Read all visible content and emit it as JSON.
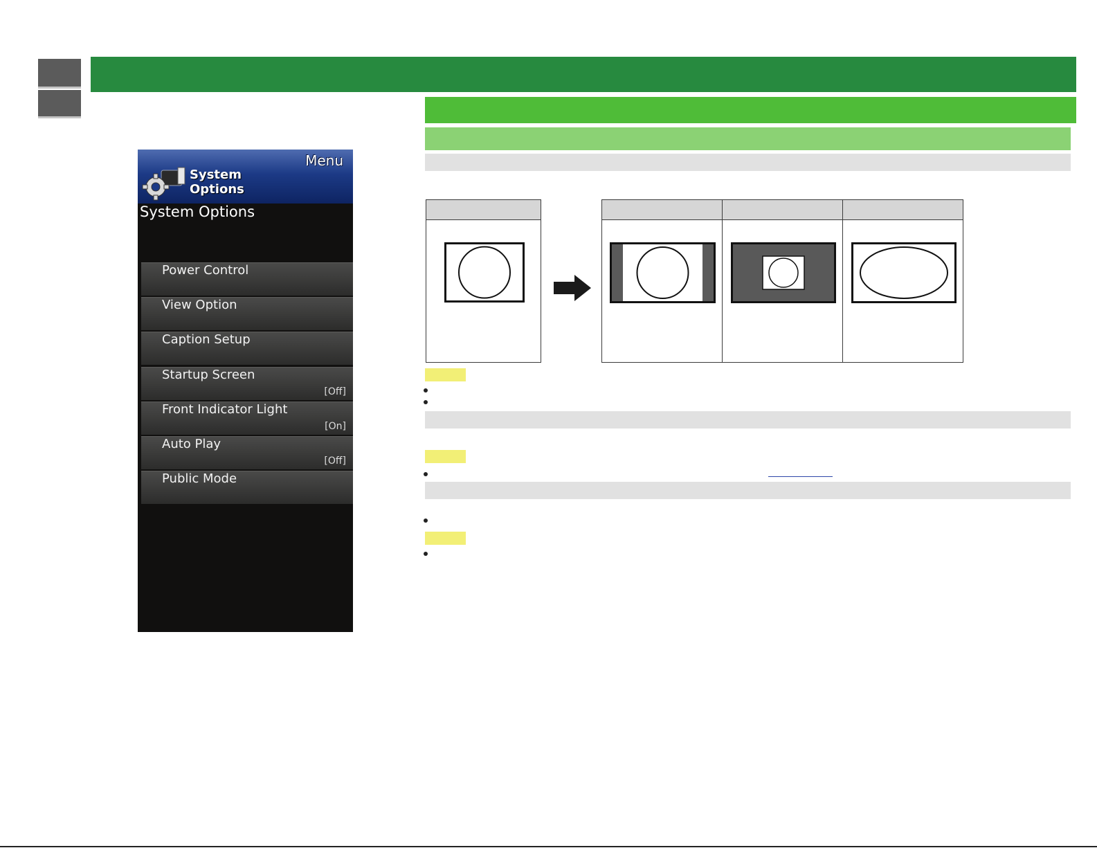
{
  "tv_menu": {
    "corner_label": "Menu",
    "header_title_line1": "System",
    "header_title_line2": "Options",
    "subtitle": "System Options",
    "items": [
      {
        "label": "Power Control",
        "value": ""
      },
      {
        "label": "View Option",
        "value": ""
      },
      {
        "label": "Caption Setup",
        "value": ""
      },
      {
        "label": "Startup Screen",
        "value": "[Off]"
      },
      {
        "label": "Front Indicator Light",
        "value": "[On]"
      },
      {
        "label": "Auto Play",
        "value": "[Off]"
      },
      {
        "label": "Public Mode",
        "value": ""
      }
    ]
  },
  "colors": {
    "top_bar": "#278a3f",
    "section_bar": "#4fbc38",
    "subsection_bar": "#8bd274",
    "heading_bar": "#e1e1e1",
    "note_chip": "#f2ef76",
    "side_tab": "#5b5b5b"
  },
  "icons": [
    "gear-icon",
    "arrow-right-icon"
  ]
}
